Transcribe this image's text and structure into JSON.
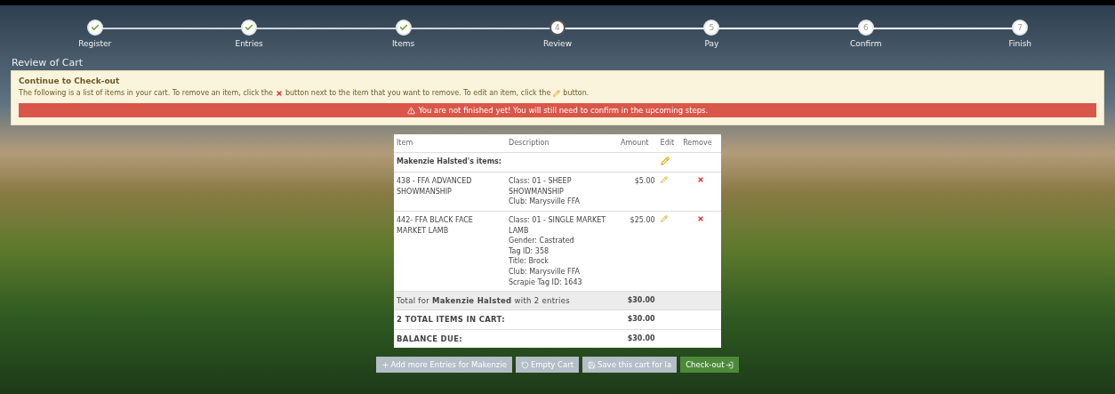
{
  "steps": [
    {
      "label": "Register",
      "done": true,
      "selected": false
    },
    {
      "label": "Entries",
      "done": true,
      "selected": false
    },
    {
      "label": "Items",
      "done": true,
      "selected": false
    },
    {
      "label": "Review",
      "number": "4",
      "done": false,
      "selected": true
    },
    {
      "label": "Pay",
      "number": "5",
      "done": false,
      "selected": false
    },
    {
      "label": "Confirm",
      "number": "6",
      "done": false,
      "selected": false
    },
    {
      "label": "Finish",
      "number": "7",
      "done": false,
      "selected": false
    }
  ],
  "page_title": "Review of Cart",
  "notice": {
    "heading": "Continue to Check-out",
    "text_before_remove": "The following is a list of items in your cart. To remove an item, click the",
    "text_middle": "button next to the item that you want to remove. To edit an item, click the",
    "text_after_edit": "button.",
    "warning": "You are not finished yet! You will still need to confirm in the upcoming steps."
  },
  "table": {
    "columns": [
      "Item",
      "Description",
      "Amount",
      "Edit",
      "Remove"
    ],
    "group": {
      "title": "Makenzie Halsted's items:",
      "editable": true
    },
    "rows": [
      {
        "item": "438 - FFA ADVANCED SHOWMANSHIP",
        "description": [
          "Class: 01 - SHEEP SHOWMANSHIP",
          "Club: Marysville FFA"
        ],
        "amount": "$5.00",
        "editable": true,
        "removable": true
      },
      {
        "item": "442- FFA BLACK FACE MARKET LAMB",
        "description": [
          "Class: 01 - SINGLE MARKET LAMB",
          "Gender: Castrated",
          "Tag ID: 358",
          "Title: Brock",
          "Club: Marysville FFA",
          "Scrapie Tag ID: 1643"
        ],
        "amount": "$25.00",
        "editable": true,
        "removable": true
      }
    ],
    "totals": [
      {
        "label": "Total for **Makenzie Halsted** with 2 entries",
        "amount": "$30.00",
        "shaded": true
      },
      {
        "label": "**2 TOTAL ITEMS IN CART:**",
        "amount": "$30.00",
        "shaded": false
      },
      {
        "label": "**BALANCE DUE:**",
        "amount": "$30.00",
        "shaded": false
      }
    ]
  },
  "buttons": [
    {
      "label": "Add more Entries for Makenzie",
      "kind": "add"
    },
    {
      "label": "Empty Cart",
      "kind": "empty"
    },
    {
      "label": "Save this cart for la",
      "kind": "save"
    },
    {
      "label": "Check-out",
      "kind": "checkout"
    }
  ]
}
